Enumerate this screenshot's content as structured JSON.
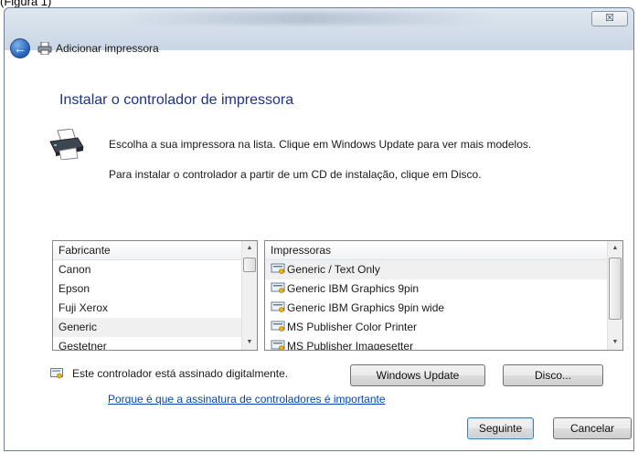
{
  "caption": "(Figura 1)",
  "window": {
    "close_glyph": "☒"
  },
  "nav": {
    "title": "Adicionar impressora"
  },
  "heading": "Instalar o controlador de impressora",
  "instructions": {
    "line1": "Escolha a sua impressora na lista. Clique em Windows Update para ver mais modelos.",
    "line2": "Para instalar o controlador a partir de um CD de instalação, clique em Disco."
  },
  "manufacturers": {
    "header": "Fabricante",
    "items": [
      "Canon",
      "Epson",
      "Fuji Xerox",
      "Generic",
      "Gestetner"
    ],
    "selected": "Generic"
  },
  "printers": {
    "header": "Impressoras",
    "items": [
      "Generic / Text Only",
      "Generic IBM Graphics 9pin",
      "Generic IBM Graphics 9pin wide",
      "MS Publisher Color Printer",
      "MS Publisher Imagesetter"
    ],
    "selected": "Generic / Text Only"
  },
  "signed_text": "Este controlador está assinado digitalmente.",
  "signing_link": "Porque é que a assinatura de controladores é importante",
  "buttons": {
    "windows_update": "Windows Update",
    "disk": "Disco...",
    "next": "Seguinte",
    "cancel": "Cancelar"
  },
  "colors": {
    "heading": "#1e3287",
    "link": "#0645ad",
    "selection": "#f0f0f0"
  }
}
